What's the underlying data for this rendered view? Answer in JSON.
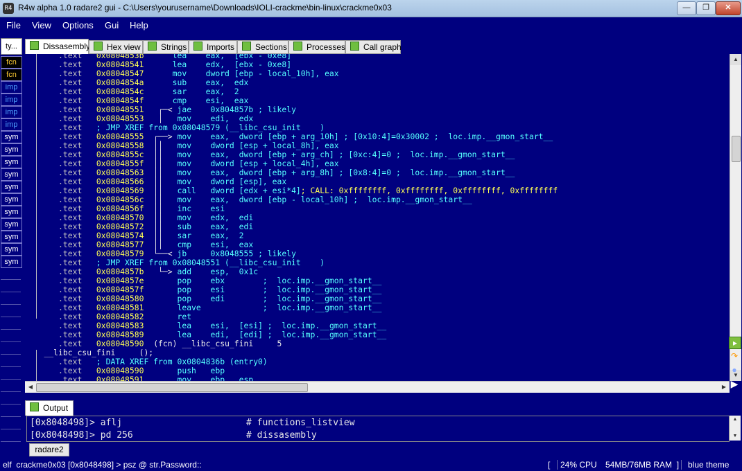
{
  "window": {
    "title": "R4w alpha 1.0 radare2 gui - C:\\Users\\yourusername\\Downloads\\IOLI-crackme\\bin-linux\\crackme0x03",
    "minimize": "—",
    "maximize": "❐",
    "close": "✕"
  },
  "menu": [
    "File",
    "View",
    "Options",
    "Gui",
    "Help"
  ],
  "sidebar": {
    "tabs": [
      "ty...",
      "fcn",
      "fcn",
      "imp",
      "imp",
      "imp",
      "imp",
      "sym",
      "sym",
      "sym",
      "sym",
      "sym",
      "sym",
      "sym",
      "sym",
      "sym",
      "sym",
      "sym"
    ]
  },
  "tabs": [
    "Dissasembly",
    "Hex view",
    "Strings",
    "Imports",
    "Sections",
    "Processes",
    "Call graph"
  ],
  "disassembly": [
    {
      "sec": ".text",
      "addr": "0x0804853b",
      "g": "      ",
      "ins": "lea    eax,  [ebx - 0xe8]",
      "cmt": ""
    },
    {
      "sec": ".text",
      "addr": "0x08048541",
      "g": "      ",
      "ins": "lea    edx,  [ebx - 0xe8]",
      "cmt": ""
    },
    {
      "sec": ".text",
      "addr": "0x08048547",
      "g": "      ",
      "ins": "mov    dword [ebp - local_10h], eax",
      "cmt": ""
    },
    {
      "sec": ".text",
      "addr": "0x0804854a",
      "g": "      ",
      "ins": "sub    eax,  edx",
      "cmt": ""
    },
    {
      "sec": ".text",
      "addr": "0x0804854c",
      "g": "      ",
      "ins": "sar    eax,  2",
      "cmt": ""
    },
    {
      "sec": ".text",
      "addr": "0x0804854f",
      "g": "      ",
      "ins": "cmp    esi,  eax",
      "cmt": ""
    },
    {
      "sec": ".text",
      "addr": "0x08048551",
      "g": "   ┌─< ",
      "ins": "jae    0x804857b",
      "cmt": " ; likely"
    },
    {
      "sec": ".text",
      "addr": "0x08048553",
      "g": "   │   ",
      "ins": "mov    edi,  edx",
      "cmt": ""
    },
    {
      "sec": ".text",
      "xref": "; JMP XREF from 0x08048579 (__libc_csu_init    )"
    },
    {
      "sec": ".text",
      "addr": "0x08048555",
      "g": "  ┌──> ",
      "ins": "mov    eax,  dword [ebp + arg_10h]",
      "cmt": " ; [0x10:4]=0x30002 ;  loc.imp.__gmon_start__"
    },
    {
      "sec": ".text",
      "addr": "0x08048558",
      "g": "  ││   ",
      "ins": "mov    dword [esp + local_8h], eax",
      "cmt": ""
    },
    {
      "sec": ".text",
      "addr": "0x0804855c",
      "g": "  ││   ",
      "ins": "mov    eax,  dword [ebp + arg_ch]",
      "cmt": " ; [0xc:4]=0 ;  loc.imp.__gmon_start__"
    },
    {
      "sec": ".text",
      "addr": "0x0804855f",
      "g": "  ││   ",
      "ins": "mov    dword [esp + local_4h], eax",
      "cmt": ""
    },
    {
      "sec": ".text",
      "addr": "0x08048563",
      "g": "  ││   ",
      "ins": "mov    eax,  dword [ebp + arg_8h]",
      "cmt": " ; [0x8:4]=0 ;  loc.imp.__gmon_start__"
    },
    {
      "sec": ".text",
      "addr": "0x08048566",
      "g": "  ││   ",
      "ins": "mov    dword [esp], eax",
      "cmt": ""
    },
    {
      "sec": ".text",
      "addr": "0x08048569",
      "g": "  ││   ",
      "ins": "call   dword [edx + esi*4]",
      "cmt": "; CALL: 0xffffffff, 0xffffffff, 0xffffffff, 0xffffffff",
      "callcolor": true
    },
    {
      "sec": ".text",
      "addr": "0x0804856c",
      "g": "  ││   ",
      "ins": "mov    eax,  dword [ebp - local_10h]",
      "cmt": " ;  loc.imp.__gmon_start__"
    },
    {
      "sec": ".text",
      "addr": "0x0804856f",
      "g": "  ││   ",
      "ins": "inc    esi",
      "cmt": ""
    },
    {
      "sec": ".text",
      "addr": "0x08048570",
      "g": "  ││   ",
      "ins": "mov    edx,  edi",
      "cmt": ""
    },
    {
      "sec": ".text",
      "addr": "0x08048572",
      "g": "  ││   ",
      "ins": "sub    eax,  edi",
      "cmt": ""
    },
    {
      "sec": ".text",
      "addr": "0x08048574",
      "g": "  ││   ",
      "ins": "sar    eax,  2",
      "cmt": ""
    },
    {
      "sec": ".text",
      "addr": "0x08048577",
      "g": "  ││   ",
      "ins": "cmp    esi,  eax",
      "cmt": ""
    },
    {
      "sec": ".text",
      "addr": "0x08048579",
      "g": "  └──< ",
      "ins": "jb     0x8048555",
      "cmt": " ; likely"
    },
    {
      "sec": ".text",
      "xref": "; JMP XREF from 0x08048551 (__libc_csu_init    )"
    },
    {
      "sec": ".text",
      "addr": "0x0804857b",
      "g": "   └─> ",
      "ins": "add    esp,  0x1c",
      "cmt": ""
    },
    {
      "sec": ".text",
      "addr": "0x0804857e",
      "g": "       ",
      "ins": "pop    ebx",
      "cmt": "        ;  loc.imp.__gmon_start__"
    },
    {
      "sec": ".text",
      "addr": "0x0804857f",
      "g": "       ",
      "ins": "pop    esi",
      "cmt": "        ;  loc.imp.__gmon_start__"
    },
    {
      "sec": ".text",
      "addr": "0x08048580",
      "g": "       ",
      "ins": "pop    edi",
      "cmt": "        ;  loc.imp.__gmon_start__"
    },
    {
      "sec": ".text",
      "addr": "0x08048581",
      "g": "       ",
      "ins": "leave",
      "cmt": "             ;  loc.imp.__gmon_start__"
    },
    {
      "sec": ".text",
      "addr": "0x08048582",
      "g": "       ",
      "ins": "ret",
      "cmt": ""
    },
    {
      "sec": ".text",
      "addr": "0x08048583",
      "g": "       ",
      "ins": "lea    esi,  [esi]",
      "cmt": " ;  loc.imp.__gmon_start__"
    },
    {
      "sec": ".text",
      "addr": "0x08048589",
      "g": "       ",
      "ins": "lea    edi,  [edi]",
      "cmt": " ;  loc.imp.__gmon_start__"
    },
    {
      "sec": ".text",
      "addr": "0x08048590",
      "fcn": "(fcn) __libc_csu_fini     5"
    },
    {
      "fname": "__libc_csu_fini     ();"
    },
    {
      "sec": ".text",
      "xref": "; DATA XREF from 0x0804836b (entry0)"
    },
    {
      "sec": ".text",
      "addr": "0x08048590",
      "g": "       ",
      "ins": "push   ebp",
      "cmt": ""
    },
    {
      "sec": ".text",
      "addr": "0x08048591",
      "g": "       ",
      "ins": "mov    ebp,  esp",
      "cmt": ""
    }
  ],
  "output_tab": "Output",
  "output": [
    {
      "prompt": "[0x8048498]> aflj",
      "comment": "# functions_listview"
    },
    {
      "prompt": "[0x8048498]> pd 256",
      "comment": "# dissasembly"
    }
  ],
  "console_tab": "radare2",
  "status": {
    "left": "elf  crackme0x03 [0x8048498] > psz @ str.Password::",
    "bracket": "[",
    "cpu": "24% CPU",
    "ram": "54MB/76MB RAM  ]",
    "theme": "blue theme"
  },
  "colors": {
    "background": "#00007f",
    "address": "#ffff55",
    "xref": "#55ffff",
    "fcn_tab": "#ffcc33",
    "imp_tab": "#4ea0ff"
  }
}
